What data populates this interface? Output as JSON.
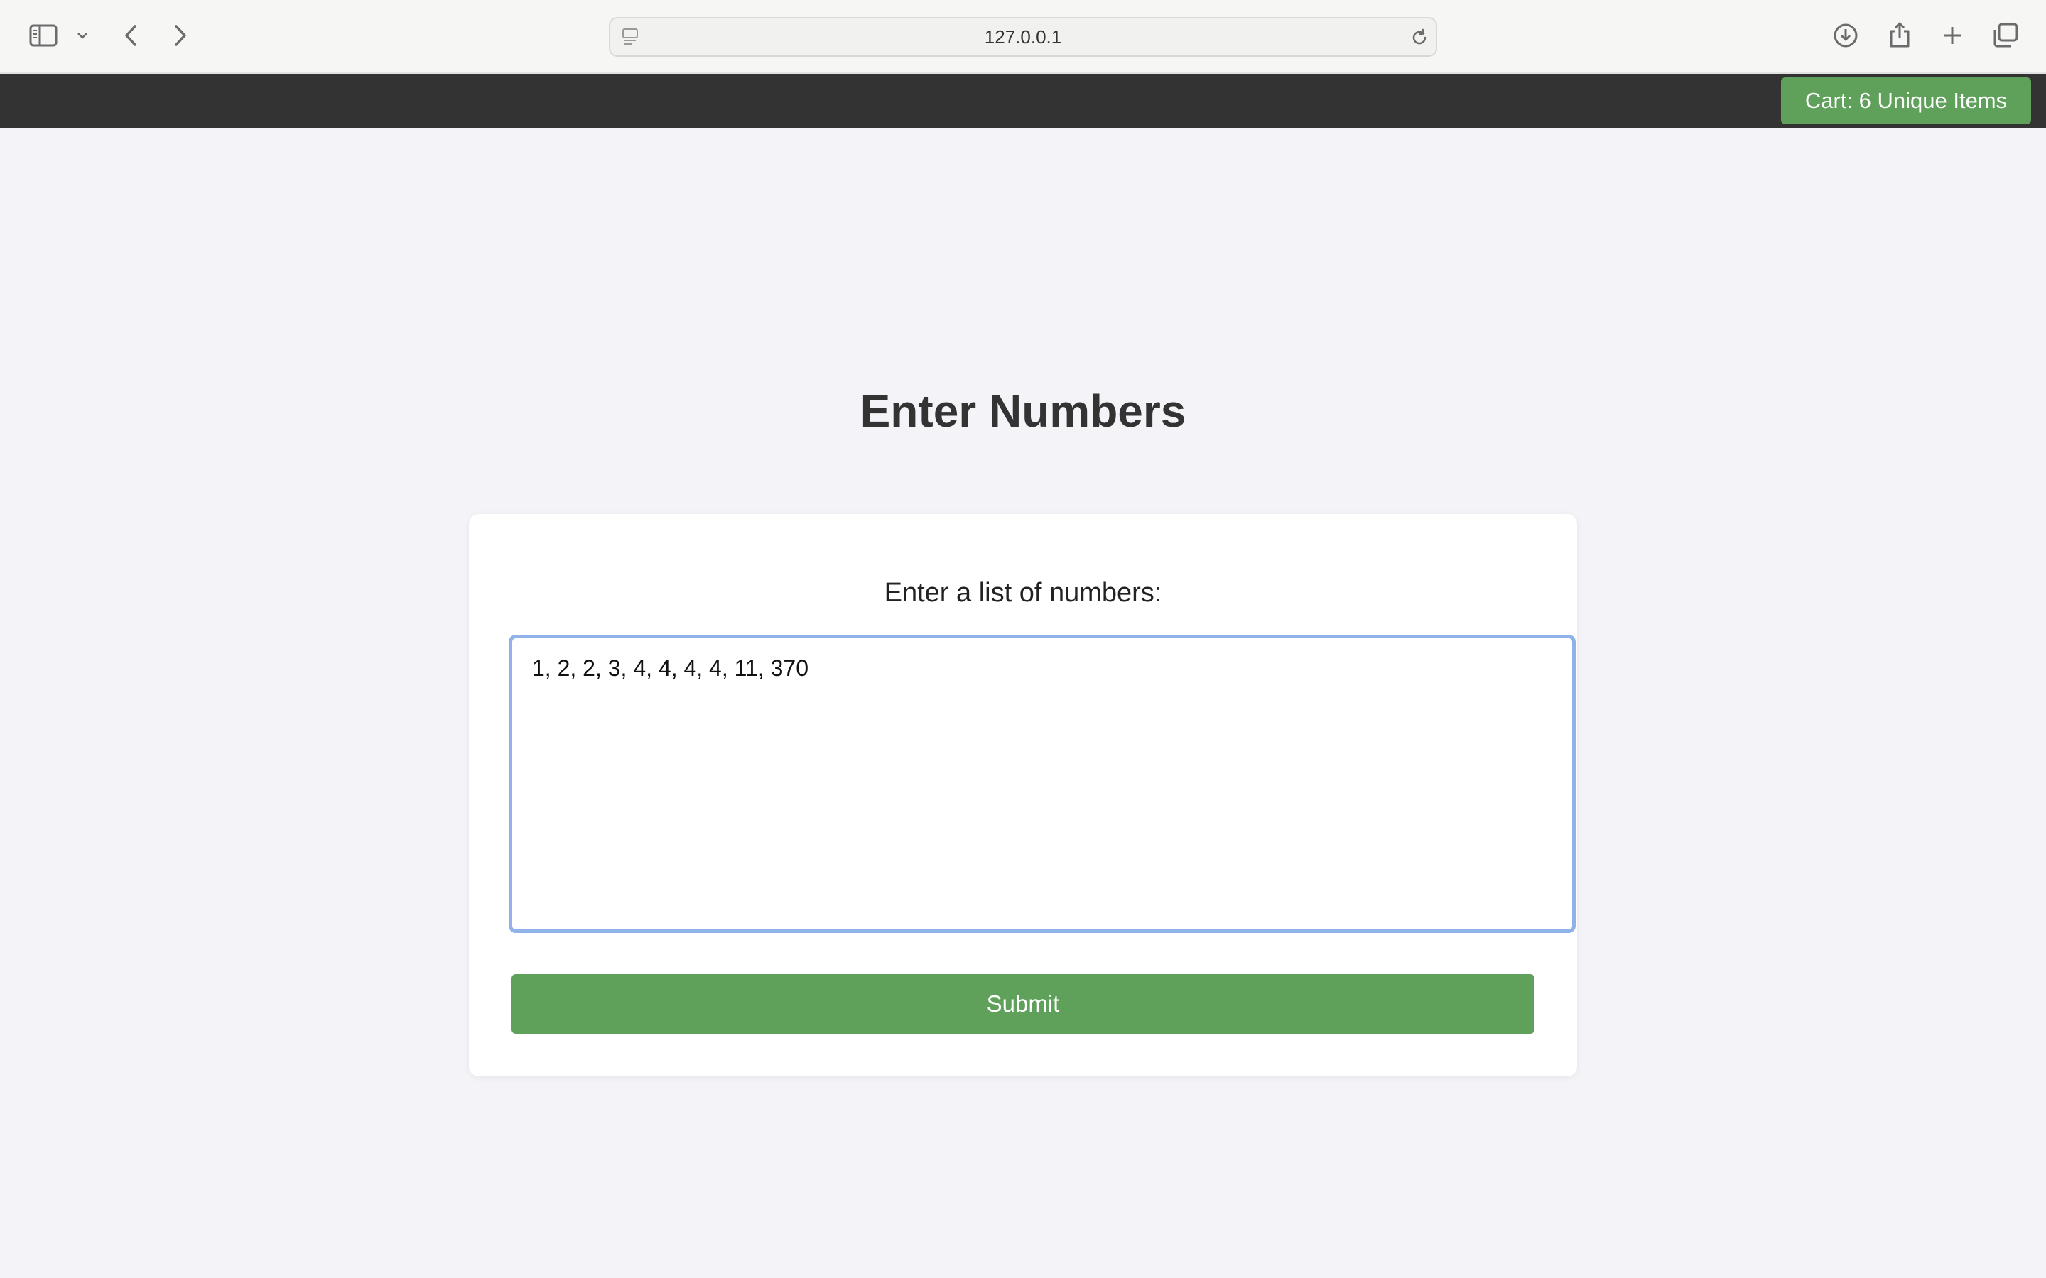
{
  "browser": {
    "url": "127.0.0.1",
    "icons": [
      "sidebar-icon",
      "chevron-down-icon",
      "back-icon",
      "forward-icon",
      "page-icon",
      "reload-icon",
      "download-icon",
      "share-icon",
      "new-tab-icon",
      "tab-overview-icon"
    ]
  },
  "header": {
    "cart_label": "Cart: 6 Unique Items",
    "background_color": "#333333",
    "accent_color": "#5fa05a"
  },
  "main": {
    "title": "Enter Numbers",
    "form": {
      "label": "Enter a list of numbers:",
      "textarea_value": "1, 2, 2, 3, 4, 4, 4, 4, 11, 370",
      "submit_label": "Submit"
    }
  }
}
